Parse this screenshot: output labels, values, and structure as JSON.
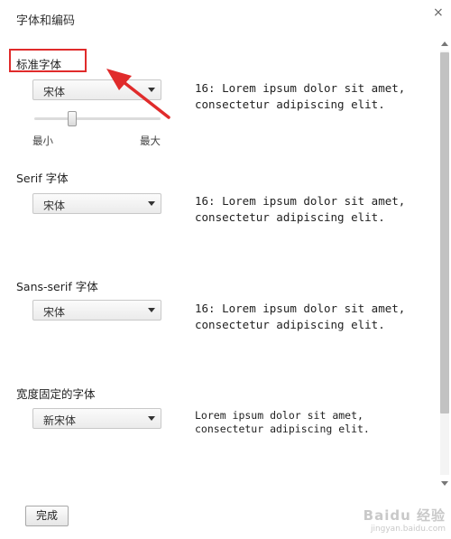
{
  "dialog": {
    "title": "字体和编码"
  },
  "sections": {
    "standard": {
      "label": "标准字体",
      "font": "宋体",
      "preview": "16: Lorem ipsum dolor sit amet, consectetur adipiscing elit."
    },
    "serif": {
      "label": "Serif 字体",
      "font": "宋体",
      "preview": "16: Lorem ipsum dolor sit amet, consectetur adipiscing elit."
    },
    "sans": {
      "label": "Sans-serif 字体",
      "font": "宋体",
      "preview": "16: Lorem ipsum dolor sit amet, consectetur adipiscing elit."
    },
    "fixed": {
      "label": "宽度固定的字体",
      "font": "新宋体",
      "preview": "Lorem ipsum dolor sit amet, consectetur adipiscing elit."
    }
  },
  "slider": {
    "min_label": "最小",
    "max_label": "最大",
    "value_fraction": 0.3
  },
  "buttons": {
    "done": "完成",
    "close": "×"
  },
  "annotation": {
    "highlight_color": "#e02b2b"
  },
  "watermark": {
    "brand": "Baidu 经验",
    "url": "jingyan.baidu.com"
  }
}
